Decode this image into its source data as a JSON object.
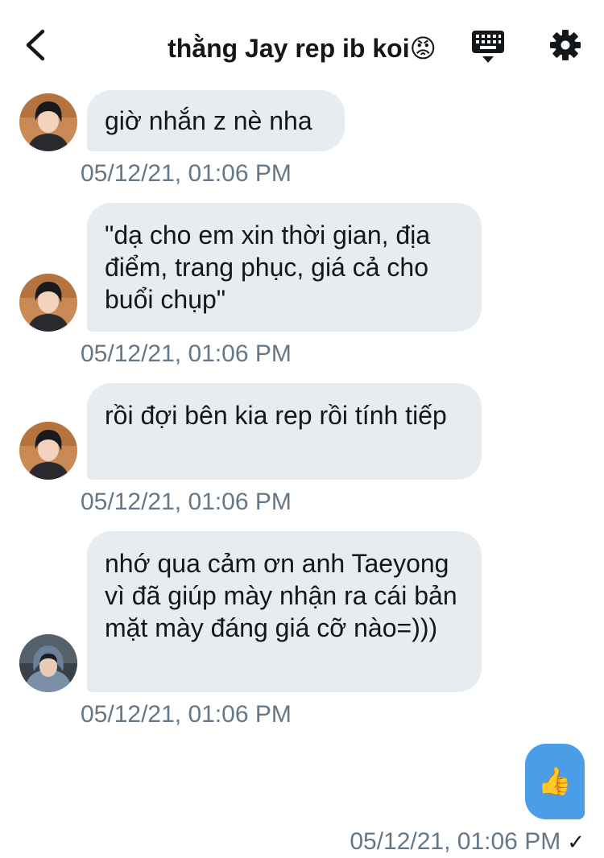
{
  "header": {
    "title": "thằng Jay rep ib koi😡",
    "back_icon": "chevron-left-icon",
    "keyboard_icon": "keyboard-icon",
    "settings_icon": "gear-icon"
  },
  "messages": [
    {
      "text": "giờ nhắn z nè nha",
      "timestamp": "05/12/21, 01:06 PM",
      "avatar": "avatar-person-1"
    },
    {
      "text": "\"dạ cho em xin thời gian, địa điểm, trang phục, giá cả cho buổi chụp\"",
      "timestamp": "05/12/21, 01:06 PM",
      "avatar": "avatar-person-1"
    },
    {
      "text": "rồi đợi bên kia rep rồi tính tiếp",
      "timestamp": "05/12/21, 01:06 PM",
      "avatar": "avatar-person-1"
    },
    {
      "text": "nhớ qua cảm ơn anh Taeyong vì đã giúp mày nhận ra cái bản mặt mày đáng giá cỡ nào=)))",
      "timestamp": "05/12/21, 01:06 PM",
      "avatar": "avatar-person-2"
    }
  ],
  "outgoing": {
    "emoji": "👍",
    "timestamp": "05/12/21, 01:06 PM",
    "status": "✓"
  },
  "colors": {
    "incoming_bubble": "#e6ecf0",
    "outgoing_bubble": "#4a9ee8",
    "timestamp": "#657786",
    "text": "#14171a"
  }
}
